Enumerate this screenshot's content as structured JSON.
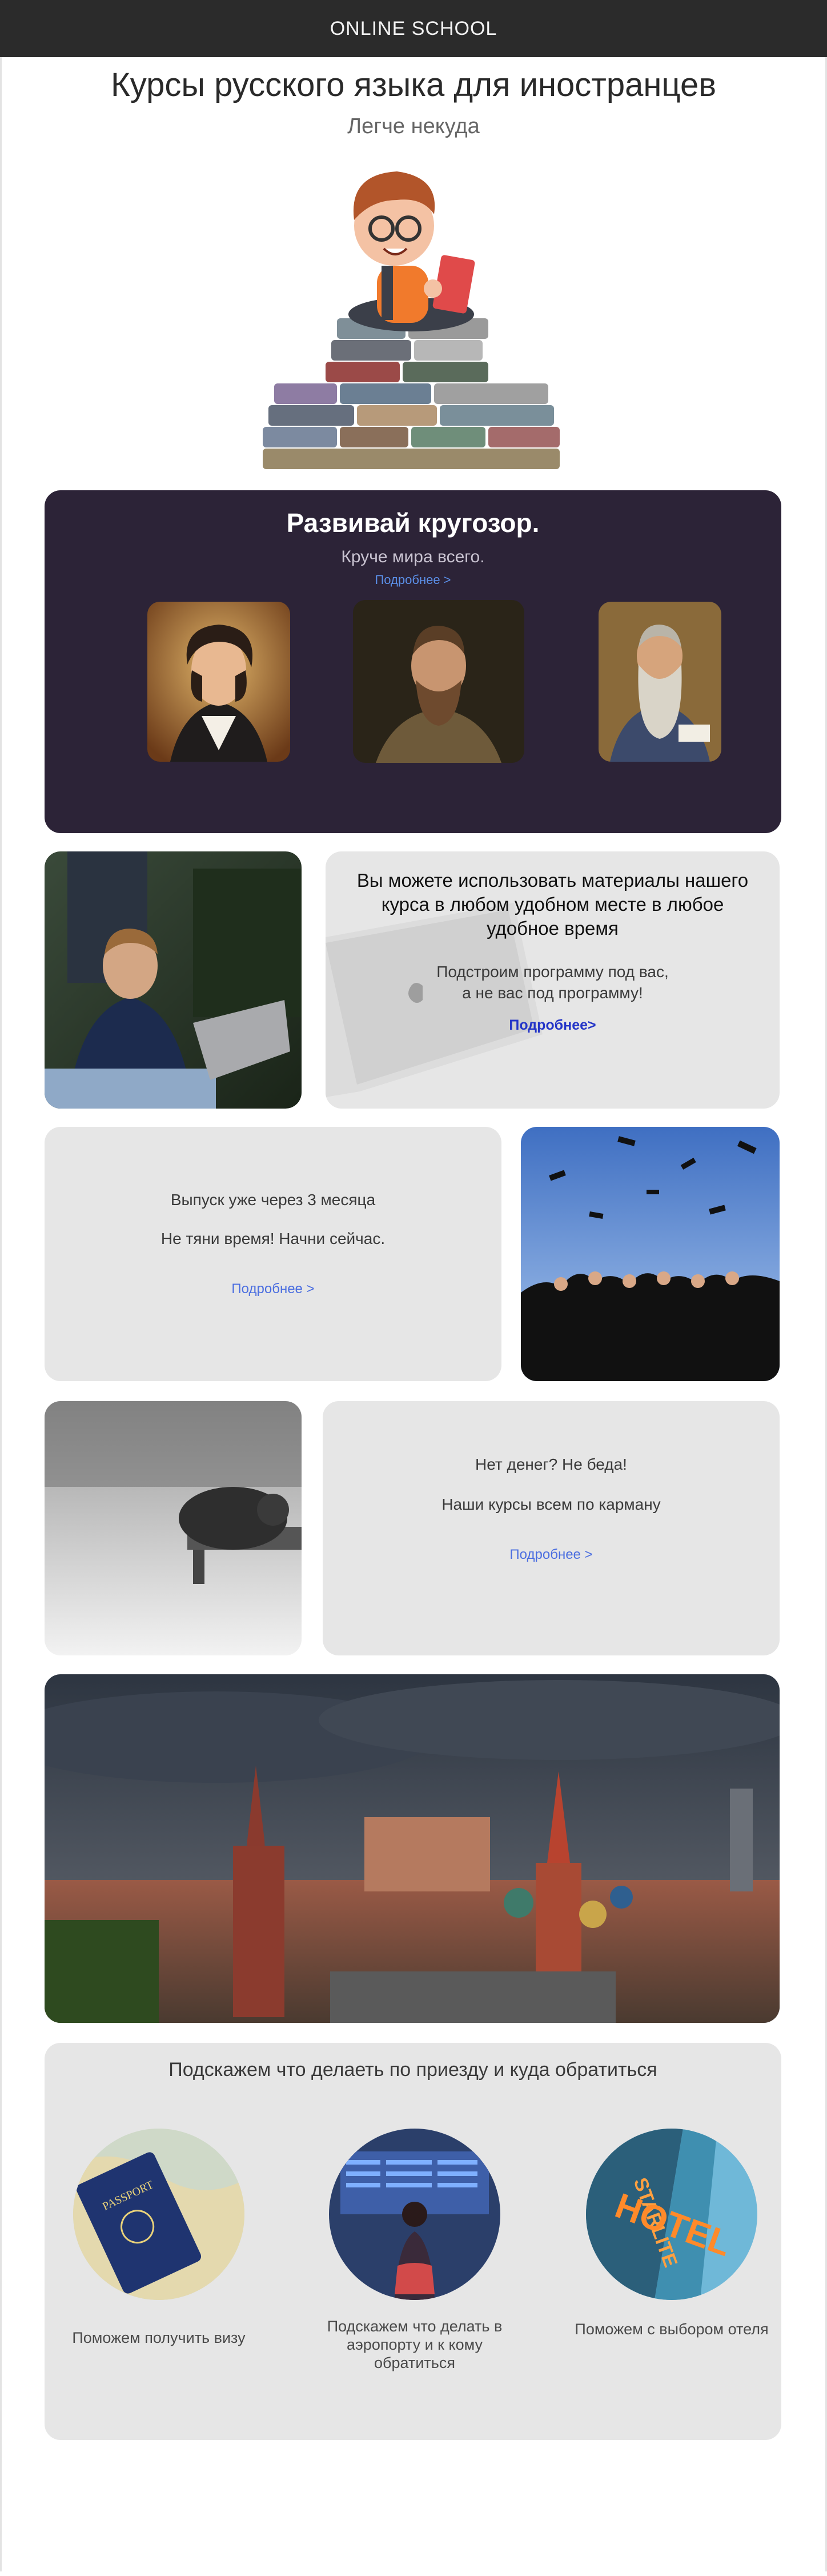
{
  "header": {
    "brand": "ONLINE SCHOOL"
  },
  "hero": {
    "title": "Курсы русского языка для иностранцев",
    "tagline": "Легче некуда"
  },
  "promo": {
    "title": "Развивай кругозор.",
    "subtitle": "Круче мира всего.",
    "link": "Подробнее >"
  },
  "material": {
    "title": "Вы можете использовать материалы нашего курса в любом удобном месте в любое удобное время",
    "line1": "Подстроим программу под вас,",
    "line2": "а не вас под программу!",
    "link": "Подробнее>"
  },
  "graduation": {
    "line1": "Выпуск уже через 3 месяца",
    "line2": "Не тяни время! Начни сейчас.",
    "link": "Подробнее >"
  },
  "money": {
    "line1": "Нет денег? Не беда!",
    "line2": "Наши курсы всем по карману",
    "link": "Подробнее >"
  },
  "help": {
    "title": "Подскажем что делаеть по приезду и куда обратиться",
    "items": [
      {
        "caption": "Поможем получить визу"
      },
      {
        "caption": "Подскажем что делать в аэропорту и к кому обратиться"
      },
      {
        "caption": "Поможем с выбором отеля"
      }
    ]
  },
  "decor_text": {
    "passport": "PASSPORT",
    "hotel": "HOTEL",
    "starlite": "STARLITE"
  },
  "colors": {
    "topbar": "#2b2b2b",
    "dark_card": "#2c2337",
    "gray_card": "#e6e6e6",
    "link": "#4b6ee0"
  }
}
